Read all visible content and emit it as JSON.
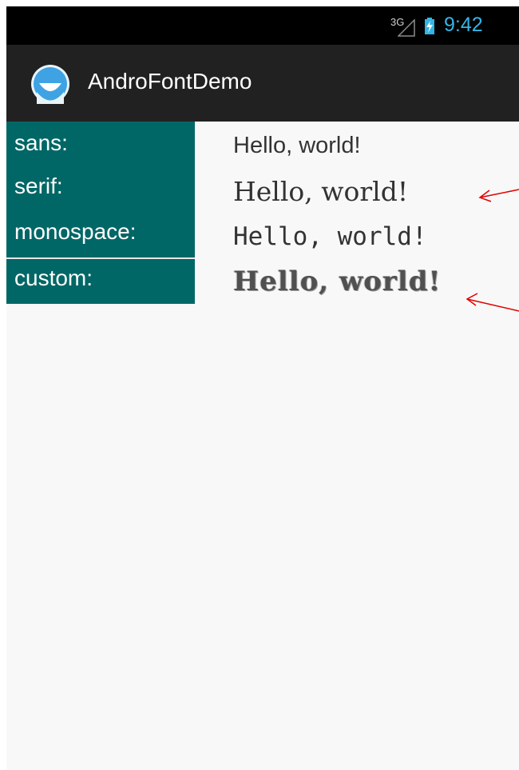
{
  "status_bar": {
    "network_label": "3G",
    "time": "9:42",
    "signal_icon": "cell-signal-icon",
    "battery_icon": "battery-charging-icon"
  },
  "action_bar": {
    "title": "AndroFontDemo",
    "app_icon": "app-logo-icon"
  },
  "rows": [
    {
      "label": "sans:",
      "sample": "Hello, world!"
    },
    {
      "label": "serif:",
      "sample": "Hello, world!"
    },
    {
      "label": "monospace:",
      "sample": "Hello, world!"
    },
    {
      "label": "custom:",
      "sample": "Hello, world!"
    }
  ],
  "colors": {
    "label_panel": "#006766",
    "status_time": "#33b5e5",
    "action_bar": "#212121",
    "annotation_arrow": "#e00000"
  }
}
